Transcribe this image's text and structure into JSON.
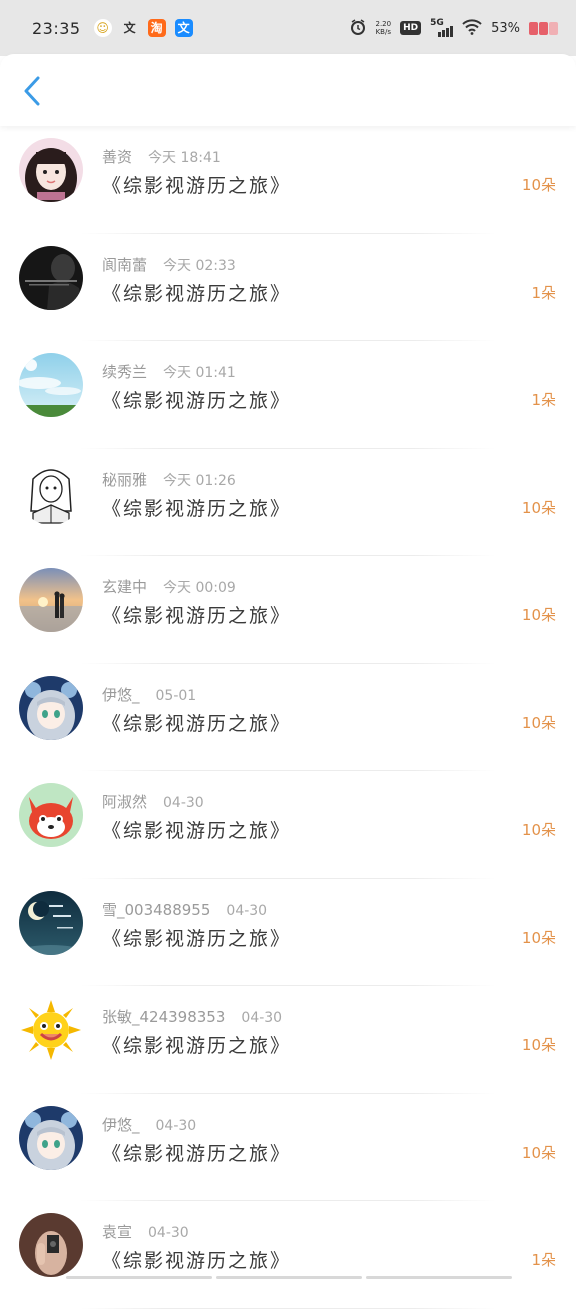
{
  "status_bar": {
    "time": "23:35",
    "app_icons": [
      {
        "name": "emoji-face-icon",
        "glyph": "☺",
        "bg": "#ffffff",
        "color": "#d6a21a"
      },
      {
        "name": "wen-icon",
        "glyph": "文",
        "bg": "transparent",
        "color": "#333333"
      },
      {
        "name": "taobao-icon",
        "glyph": "淘",
        "bg": "#ff6a1a",
        "color": "#ffffff"
      },
      {
        "name": "wen-blue-icon",
        "glyph": "文",
        "bg": "#1a8cff",
        "color": "#ffffff"
      }
    ],
    "network_speed_value": "2.20",
    "network_speed_unit": "KB/s",
    "hd_label": "HD",
    "signal_label": "5G",
    "battery_percent": "53%"
  },
  "header": {
    "back_icon": "chevron-left-icon",
    "accent_color": "#3b9be6"
  },
  "gifts": [
    {
      "user": "善资",
      "time": "今天 18:41",
      "book": "《综影视游历之旅》",
      "amount": "10朵",
      "avatar": "girl-portrait"
    },
    {
      "user": "阆南蕾",
      "time": "今天 02:33",
      "book": "《综影视游历之旅》",
      "amount": "1朵",
      "avatar": "dark-photo"
    },
    {
      "user": "续秀兰",
      "time": "今天 01:41",
      "book": "《综影视游历之旅》",
      "amount": "1朵",
      "avatar": "sky-landscape"
    },
    {
      "user": "秘丽雅",
      "time": "今天 01:26",
      "book": "《综影视游历之旅》",
      "amount": "10朵",
      "avatar": "sketch-girl"
    },
    {
      "user": "玄建中",
      "time": "今天 00:09",
      "book": "《综影视游历之旅》",
      "amount": "10朵",
      "avatar": "sunset-couple"
    },
    {
      "user": "伊悠_",
      "time": "05-01",
      "book": "《综影视游历之旅》",
      "amount": "10朵",
      "avatar": "anime-girl"
    },
    {
      "user": "阿淑然",
      "time": "04-30",
      "book": "《综影视游历之旅》",
      "amount": "10朵",
      "avatar": "red-fox"
    },
    {
      "user": "雪_003488955",
      "time": "04-30",
      "book": "《综影视游历之旅》",
      "amount": "10朵",
      "avatar": "moon-text"
    },
    {
      "user": "张敏_424398353",
      "time": "04-30",
      "book": "《综影视游历之旅》",
      "amount": "10朵",
      "avatar": "smiling-sun"
    },
    {
      "user": "伊悠_",
      "time": "04-30",
      "book": "《综影视游历之旅》",
      "amount": "10朵",
      "avatar": "anime-girl"
    },
    {
      "user": "袁宣",
      "time": "04-30",
      "book": "《综影视游历之旅》",
      "amount": "1朵",
      "avatar": "hand-photo"
    }
  ],
  "colors": {
    "amount": "#e3924a",
    "book_title": "#3a3a3a",
    "meta_text": "#9a9a9a"
  }
}
